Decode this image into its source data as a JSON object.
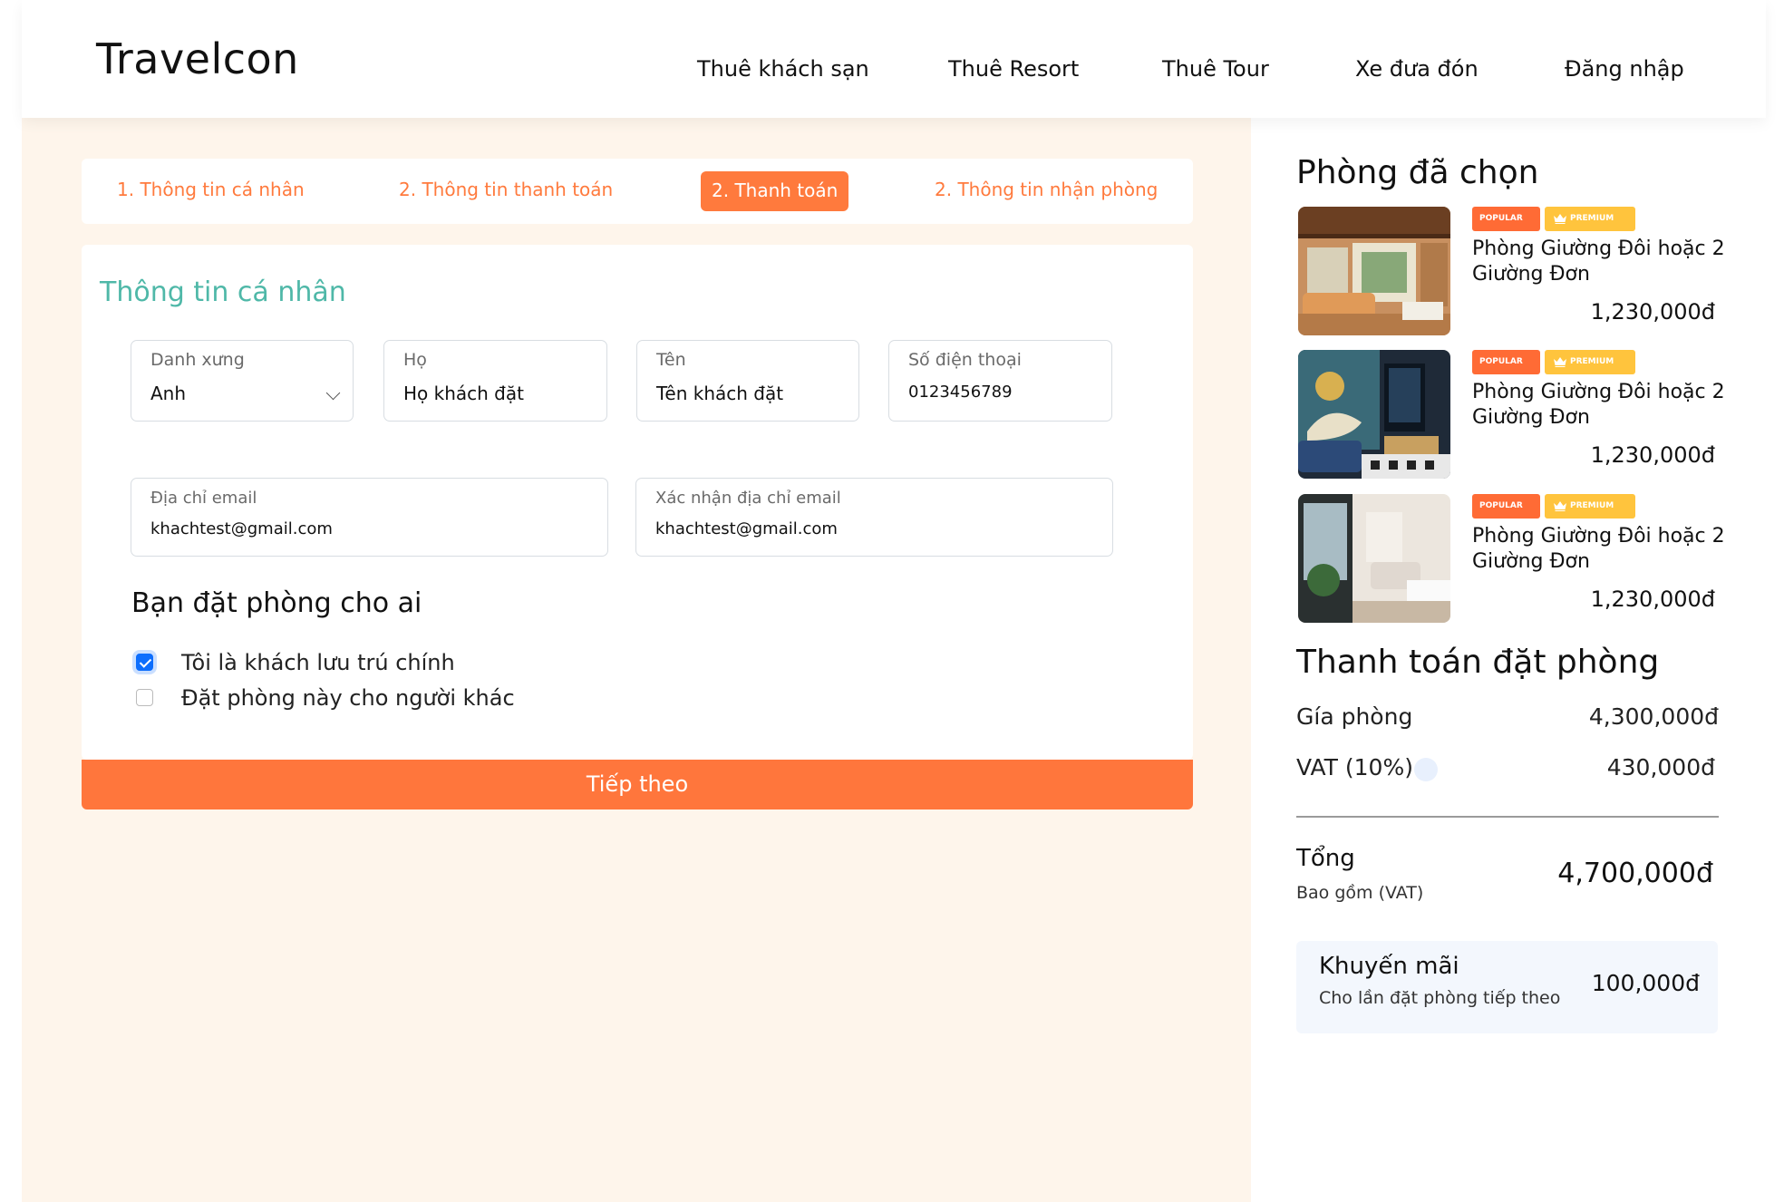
{
  "header": {
    "logo": "Travelcon",
    "nav": [
      "Thuê khách sạn",
      "Thuê Resort",
      "Thuê Tour",
      "Xe đưa đón",
      "Đăng nhập"
    ]
  },
  "steps": [
    {
      "label": "1. Thông tin cá nhân",
      "active": false
    },
    {
      "label": "2. Thông tin thanh toán",
      "active": false
    },
    {
      "label": "2. Thanh toán",
      "active": true
    },
    {
      "label": "2. Thông tin nhận phòng",
      "active": false
    }
  ],
  "form": {
    "title": "Thông tin cá nhân",
    "salutation": {
      "label": "Danh xưng",
      "value": "Anh"
    },
    "last_name": {
      "label": "Họ",
      "value": "Họ khách đặt"
    },
    "first_name": {
      "label": "Tên",
      "value": "Tên khách đặt"
    },
    "phone": {
      "label": "Số điện thoại",
      "value": "0123456789"
    },
    "email": {
      "label": "Địa chỉ email",
      "value": "khachtest@gmail.com"
    },
    "email_confirm": {
      "label": "Xác nhận địa chỉ email",
      "value": "khachtest@gmail.com"
    },
    "who_title": "Bạn đặt phòng cho ai",
    "options": [
      {
        "label": "Tôi là khách lưu trú chính",
        "checked": true
      },
      {
        "label": "Đặt phòng này cho người khác",
        "checked": false
      }
    ],
    "next_label": "Tiếp theo"
  },
  "sidebar": {
    "selected_title": "Phòng đã chọn",
    "rooms": [
      {
        "badge_popular": "POPULAR",
        "badge_premium": "PREMIUM",
        "name": "Phòng Giường Đôi hoặc 2 Giường Đơn",
        "price": "1,230,000đ"
      },
      {
        "badge_popular": "POPULAR",
        "badge_premium": "PREMIUM",
        "name": "Phòng Giường Đôi hoặc 2 Giường Đơn",
        "price": "1,230,000đ"
      },
      {
        "badge_popular": "POPULAR",
        "badge_premium": "PREMIUM",
        "name": "Phòng Giường Đôi hoặc 2 Giường Đơn",
        "price": "1,230,000đ"
      }
    ],
    "payment_title": "Thanh toán đặt phòng",
    "room_price_label": "Gía phòng",
    "room_price_value": "4,300,000đ",
    "vat_label": "VAT (10%)",
    "vat_value": "430,000đ",
    "total_label": "Tổng",
    "total_note": "Bao gồm (VAT)",
    "total_value": "4,700,000đ",
    "promo_title": "Khuyến mãi",
    "promo_note": "Cho lần đặt phòng tiếp theo",
    "promo_value": "100,000đ"
  },
  "colors": {
    "accent": "#ff7a3d",
    "teal": "#4fb8a8",
    "page_bg": "#fef5eb",
    "checkbox": "#0d6efd",
    "premium": "#ffc43d"
  }
}
